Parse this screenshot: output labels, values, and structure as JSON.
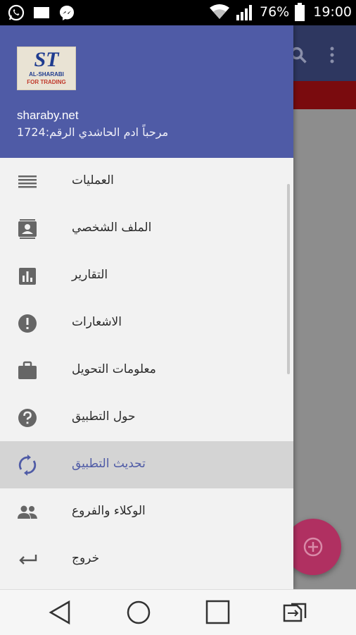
{
  "status_bar": {
    "left_icons": [
      "whatsapp-icon",
      "message-icon",
      "messenger-icon"
    ],
    "wifi": "wifi-icon",
    "signal": "signal-icon",
    "battery_percent": "76%",
    "time": "19:00"
  },
  "drawer": {
    "header": {
      "logo_mark": "ST",
      "logo_line1": "AL-SHARABI",
      "logo_line2": "FOR TRADING",
      "site": "sharaby.net",
      "welcome": "مرحباً ادم الحاشدي الرقم:1724"
    },
    "items": [
      {
        "label": "العمليات",
        "icon": "list-icon",
        "active": false
      },
      {
        "label": "الملف الشخصي",
        "icon": "contact-card-icon",
        "active": false
      },
      {
        "label": "التقارير",
        "icon": "bar-chart-icon",
        "active": false
      },
      {
        "label": "الاشعارات",
        "icon": "alert-icon",
        "active": false
      },
      {
        "label": "معلومات التحويل",
        "icon": "briefcase-icon",
        "active": false
      },
      {
        "label": "حول التطبيق",
        "icon": "help-icon",
        "active": false
      },
      {
        "label": "تحديث التطبيق",
        "icon": "sync-icon",
        "active": true
      },
      {
        "label": "الوكلاء والفروع",
        "icon": "people-icon",
        "active": false
      },
      {
        "label": "خروج",
        "icon": "exit-arrow-icon",
        "active": false
      }
    ]
  },
  "colors": {
    "header_bg": "#4f5ba6",
    "active_text": "#4f5ba6",
    "fab": "#b03061"
  },
  "nav_bar": [
    "back-icon",
    "home-icon",
    "recents-icon",
    "switch-sim-icon"
  ]
}
